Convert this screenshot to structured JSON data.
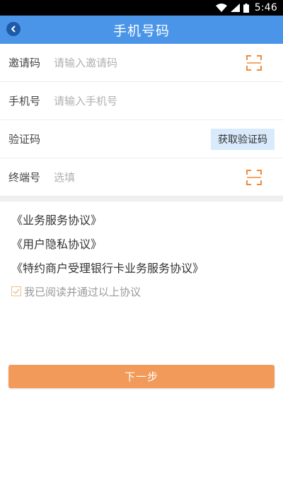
{
  "status_bar": {
    "time": "5:46",
    "icons": [
      "wifi-icon",
      "signal-icon",
      "battery-icon"
    ]
  },
  "header": {
    "title": "手机号码",
    "back_icon": "chevron-left-icon",
    "color": "#4a95e8"
  },
  "form": {
    "invite": {
      "label": "邀请码",
      "placeholder": "请输入邀请码",
      "action_icon": "scan-icon"
    },
    "phone": {
      "label": "手机号",
      "placeholder": "请输入手机号"
    },
    "verify": {
      "label": "验证码",
      "button": "获取验证码"
    },
    "terminal": {
      "label": "终端号",
      "placeholder": "选填",
      "action_icon": "scan-icon"
    }
  },
  "agreements": [
    "《业务服务协议》",
    "《用户隐私协议》",
    "《特约商户受理银行卡业务服务协议》"
  ],
  "consent": {
    "text": "我已阅读并通过以上协议",
    "checked": true
  },
  "next_button": {
    "label": "下一步",
    "color": "#f19a5a"
  },
  "accent": {
    "scan": "#f08a3a"
  }
}
